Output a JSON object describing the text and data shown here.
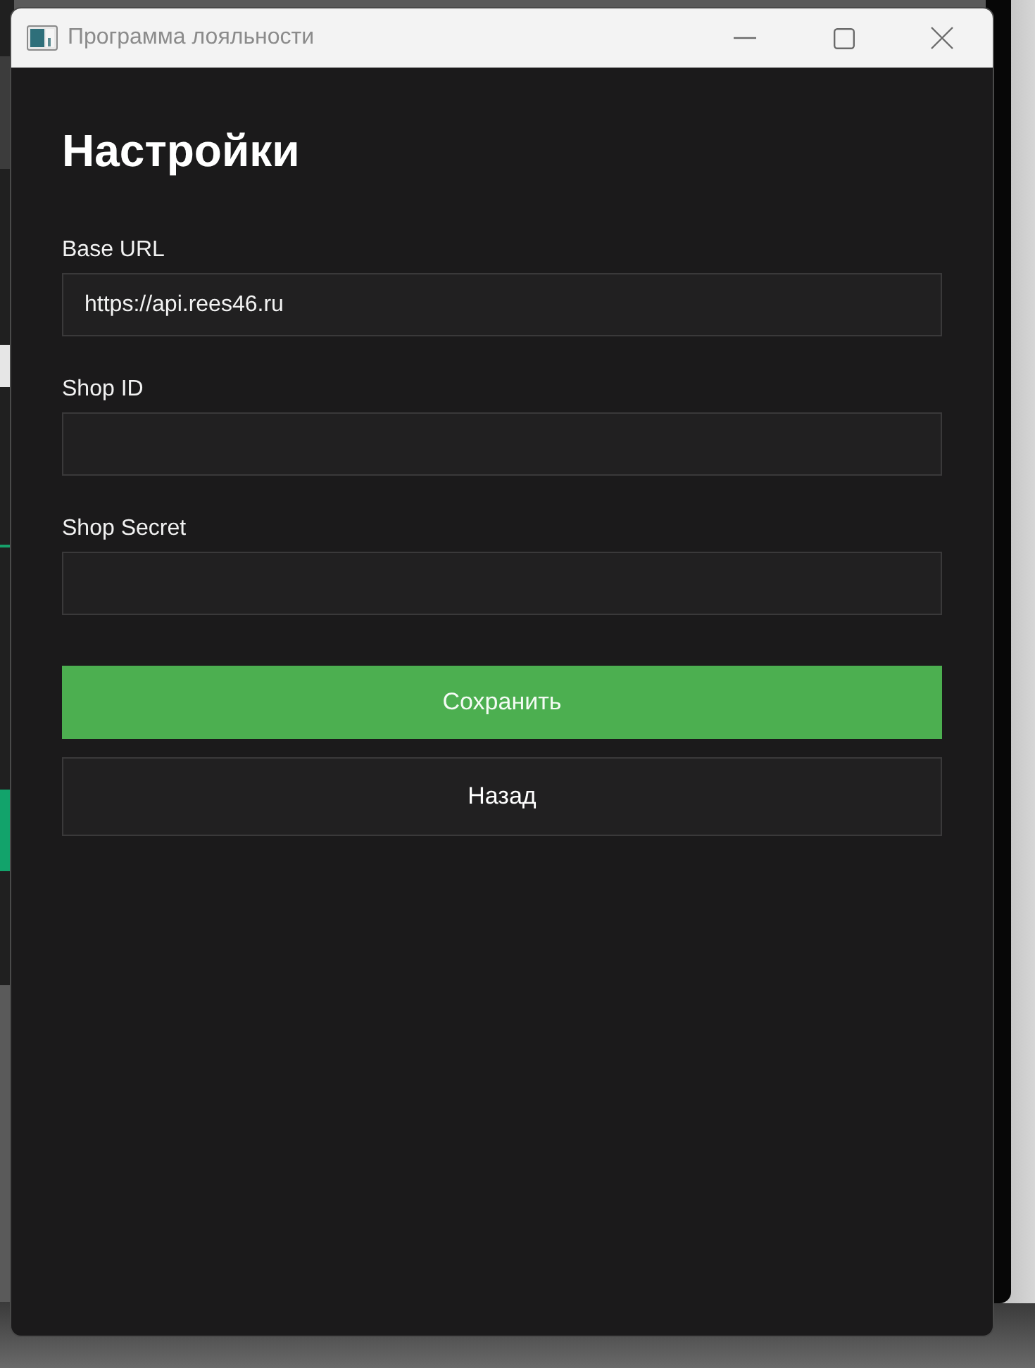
{
  "window": {
    "title": "Программа лояльности"
  },
  "heading": "Настройки",
  "fields": [
    {
      "label": "Base URL",
      "value": "https://api.rees46.ru"
    },
    {
      "label": "Shop ID"
    },
    {
      "label": "Shop Secret"
    }
  ],
  "buttons": [
    {
      "label": "Сохранить",
      "kind": "primary"
    },
    {
      "label": "Назад",
      "kind": "secondary"
    }
  ]
}
